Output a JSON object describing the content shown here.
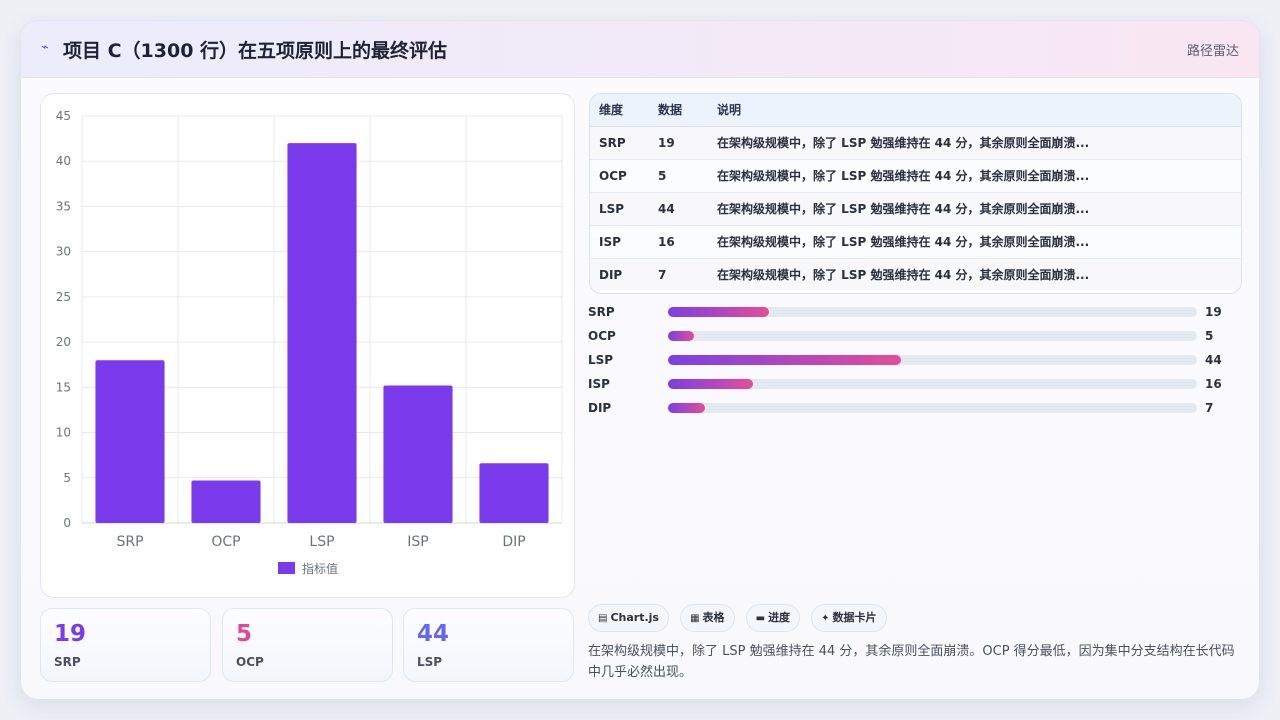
{
  "header": {
    "icon": "trend-icon",
    "title": "项目 C（1300 行）在五项原则上的最终评估",
    "badge": "路径雷达"
  },
  "colors": {
    "bar": "#7c3aed",
    "accent_purple": "#7c3aed",
    "accent_pink": "#e0489a",
    "accent_indigo": "#6366f1"
  },
  "chart_data": {
    "type": "bar",
    "categories": [
      "SRP",
      "OCP",
      "LSP",
      "ISP",
      "DIP"
    ],
    "series": [
      {
        "name": "指标值",
        "values": [
          18,
          4.7,
          42,
          15.2,
          6.6
        ]
      }
    ],
    "ylim": [
      0,
      45
    ],
    "yticks": [
      0,
      5,
      10,
      15,
      20,
      25,
      30,
      35,
      40,
      45
    ],
    "legend": "bottom",
    "grid": true
  },
  "stats": [
    {
      "value": "19",
      "label": "SRP",
      "color": "#7c3aed"
    },
    {
      "value": "5",
      "label": "OCP",
      "color": "#e0489a"
    },
    {
      "value": "44",
      "label": "LSP",
      "color": "#6366f1"
    }
  ],
  "table": {
    "headers": [
      "维度",
      "数据",
      "说明"
    ],
    "rows": [
      [
        "SRP",
        "19",
        "在架构级规模中，除了 LSP 勉强维持在 44 分，其余原则全面崩溃..."
      ],
      [
        "OCP",
        "5",
        "在架构级规模中，除了 LSP 勉强维持在 44 分，其余原则全面崩溃..."
      ],
      [
        "LSP",
        "44",
        "在架构级规模中，除了 LSP 勉强维持在 44 分，其余原则全面崩溃..."
      ],
      [
        "ISP",
        "16",
        "在架构级规模中，除了 LSP 勉强维持在 44 分，其余原则全面崩溃..."
      ],
      [
        "DIP",
        "7",
        "在架构级规模中，除了 LSP 勉强维持在 44 分，其余原则全面崩溃..."
      ]
    ]
  },
  "progress": [
    {
      "label": "SRP",
      "value": "19",
      "fraction": 0.19
    },
    {
      "label": "OCP",
      "value": "5",
      "fraction": 0.05
    },
    {
      "label": "LSP",
      "value": "44",
      "fraction": 0.44
    },
    {
      "label": "ISP",
      "value": "16",
      "fraction": 0.16
    },
    {
      "label": "DIP",
      "value": "7",
      "fraction": 0.07
    }
  ],
  "chips": [
    {
      "icon": "chart-icon",
      "glyph": "▤",
      "label": "Chart.js"
    },
    {
      "icon": "table-icon",
      "glyph": "▦",
      "label": "表格"
    },
    {
      "icon": "progress-icon",
      "glyph": "▬",
      "label": "进度"
    },
    {
      "icon": "sparkle-icon",
      "glyph": "✦",
      "label": "数据卡片"
    }
  ],
  "summary": "在架构级规模中，除了 LSP 勉强维持在 44 分，其余原则全面崩溃。OCP 得分最低，因为集中分支结构在长代码中几乎必然出现。"
}
